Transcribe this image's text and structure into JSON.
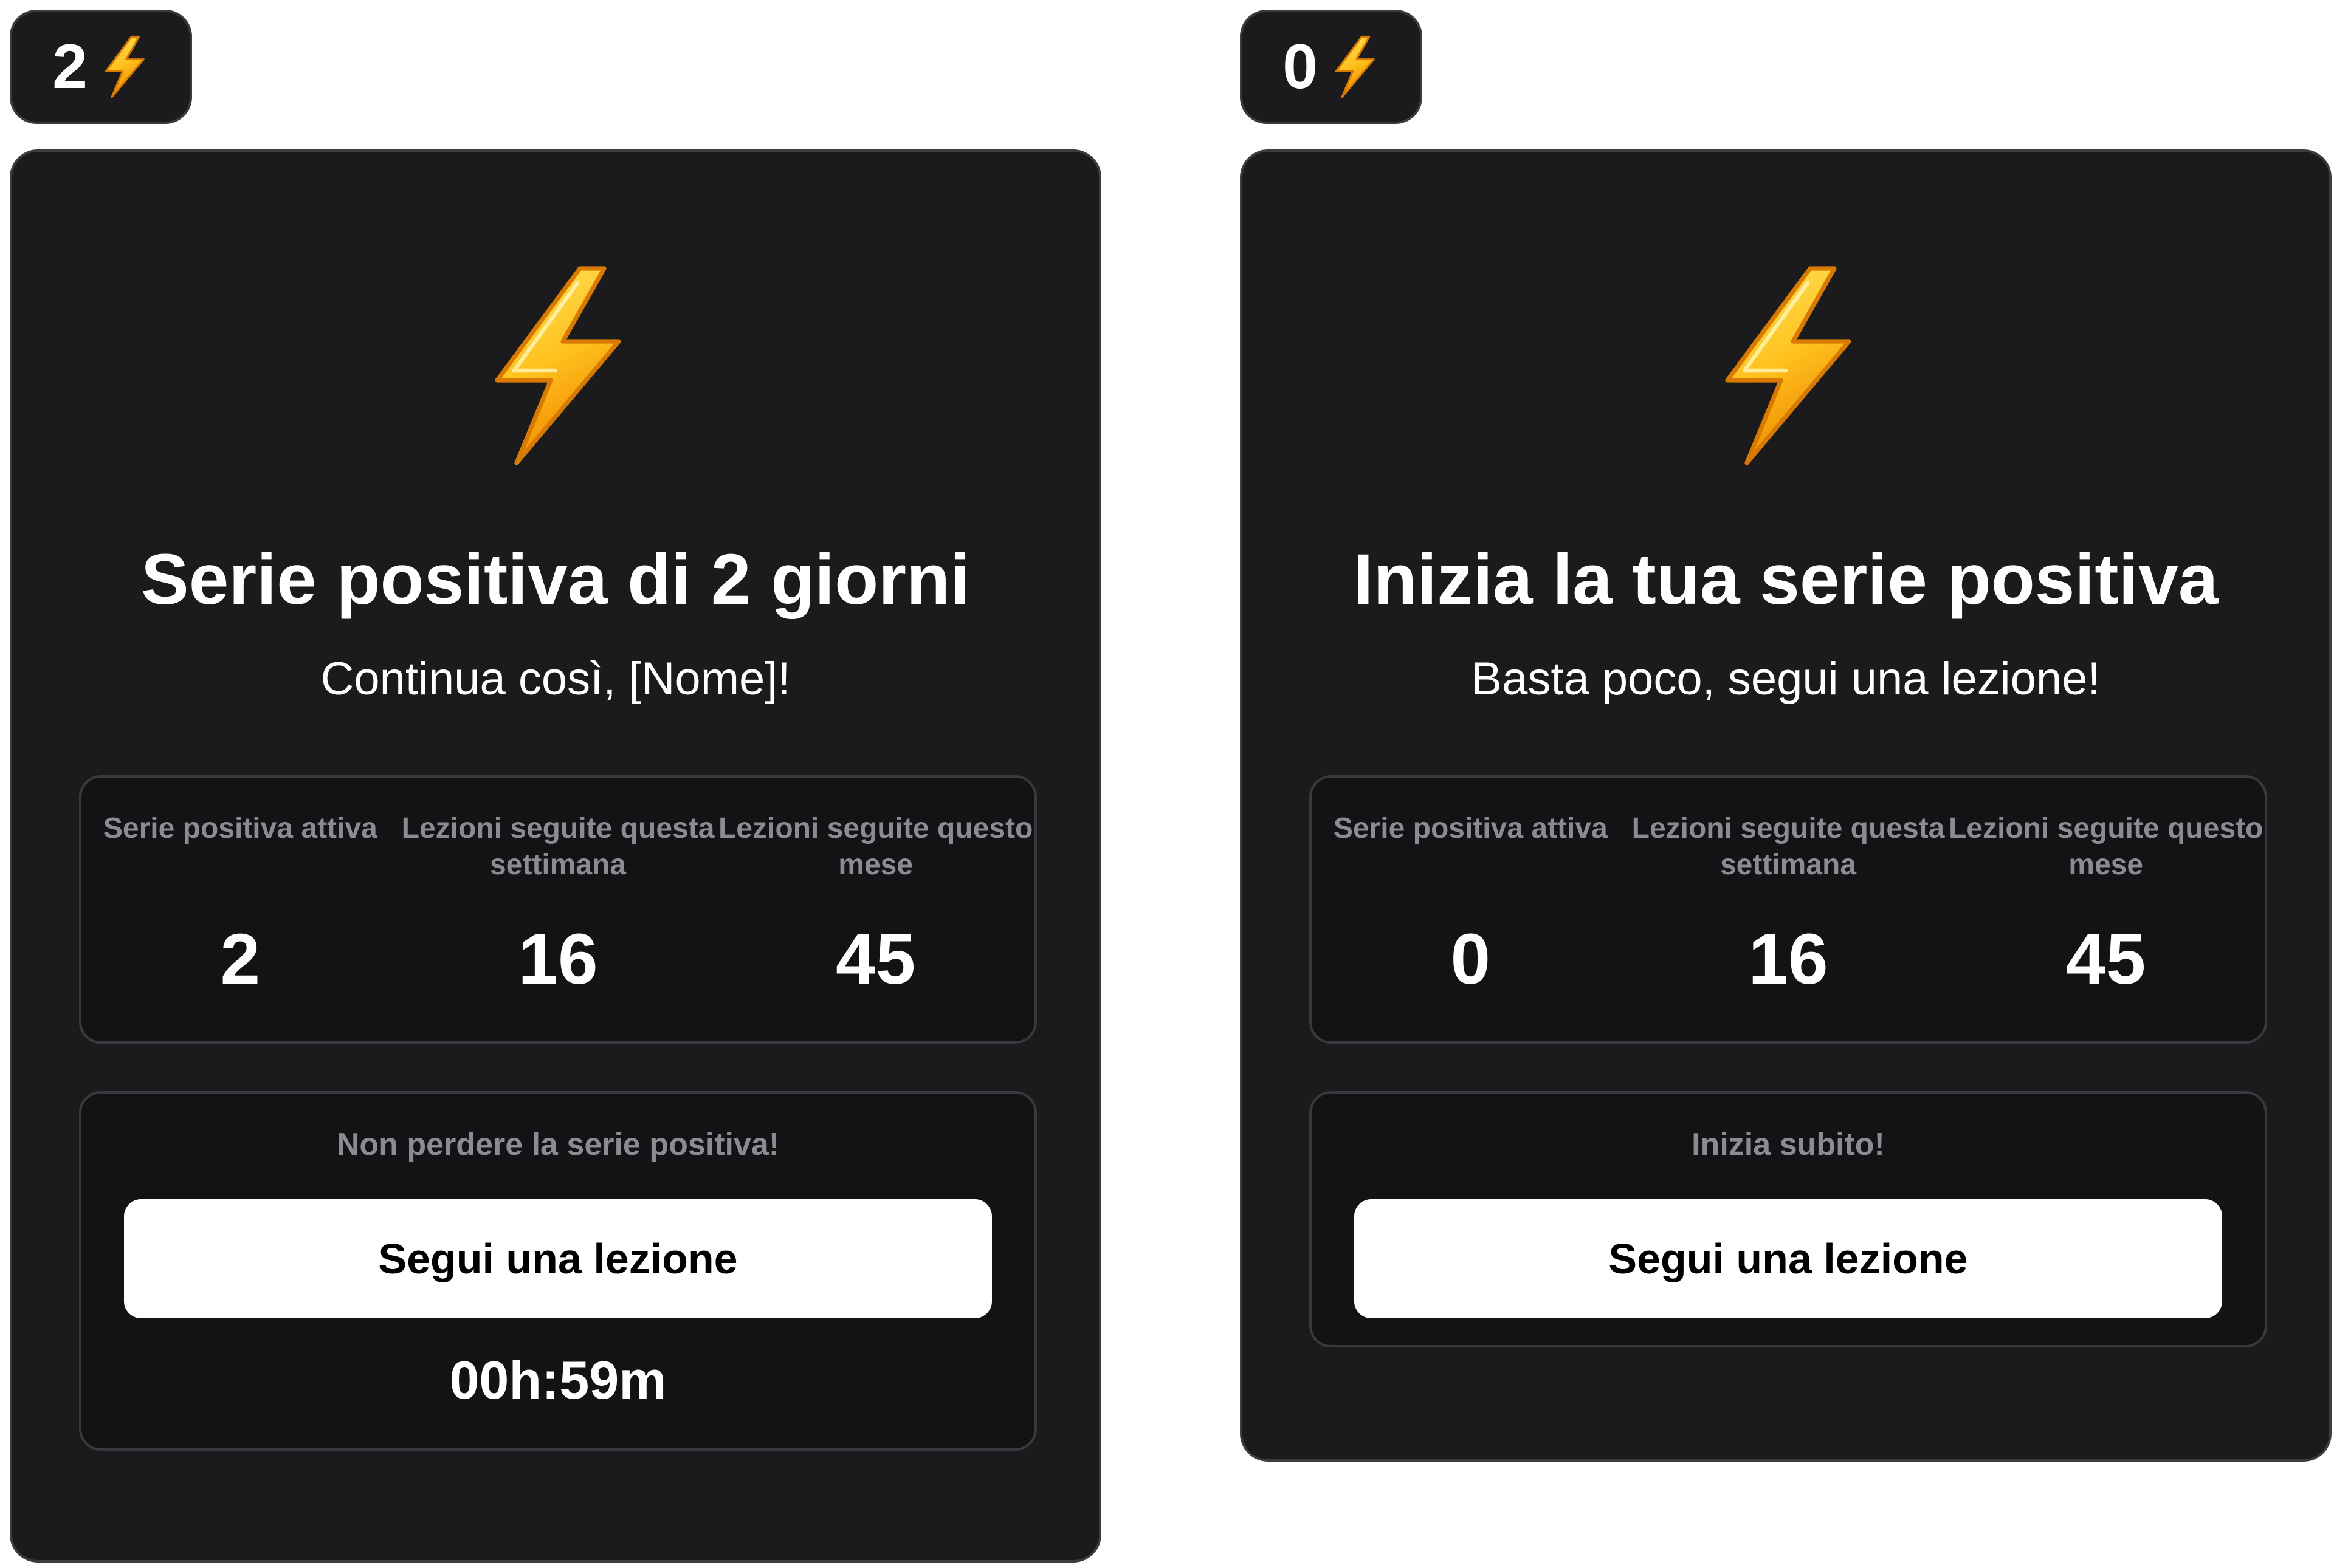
{
  "colors": {
    "card_background": "#1b1b1d",
    "panel_background": "#131315",
    "border": "#3a3a3e",
    "muted_text": "#8b8c92",
    "text": "#ffffff",
    "button_background": "#ffffff",
    "button_text": "#000000",
    "bolt_light": "#ffd43a",
    "bolt_dark": "#f59a0c"
  },
  "icons": {
    "badge": "lightning-bolt",
    "hero": "lightning-bolt"
  },
  "variants": [
    {
      "badge_count": "2",
      "title": "Serie positiva di 2 giorni",
      "subtitle": "Continua così, [Nome]!",
      "stats": [
        {
          "label": "Serie positiva attiva",
          "value": "2"
        },
        {
          "label": "Lezioni seguite questa settimana",
          "value": "16"
        },
        {
          "label": "Lezioni seguite questo mese",
          "value": "45"
        }
      ],
      "cta_hint": "Non perdere la serie positiva!",
      "cta_button": "Segui una lezione",
      "timer": "00h:59m"
    },
    {
      "badge_count": "0",
      "title": "Inizia la tua serie positiva",
      "subtitle": "Basta poco, segui una lezione!",
      "stats": [
        {
          "label": "Serie positiva attiva",
          "value": "0"
        },
        {
          "label": "Lezioni seguite questa settimana",
          "value": "16"
        },
        {
          "label": "Lezioni seguite questo mese",
          "value": "45"
        }
      ],
      "cta_hint": "Inizia subito!",
      "cta_button": "Segui una lezione"
    }
  ]
}
